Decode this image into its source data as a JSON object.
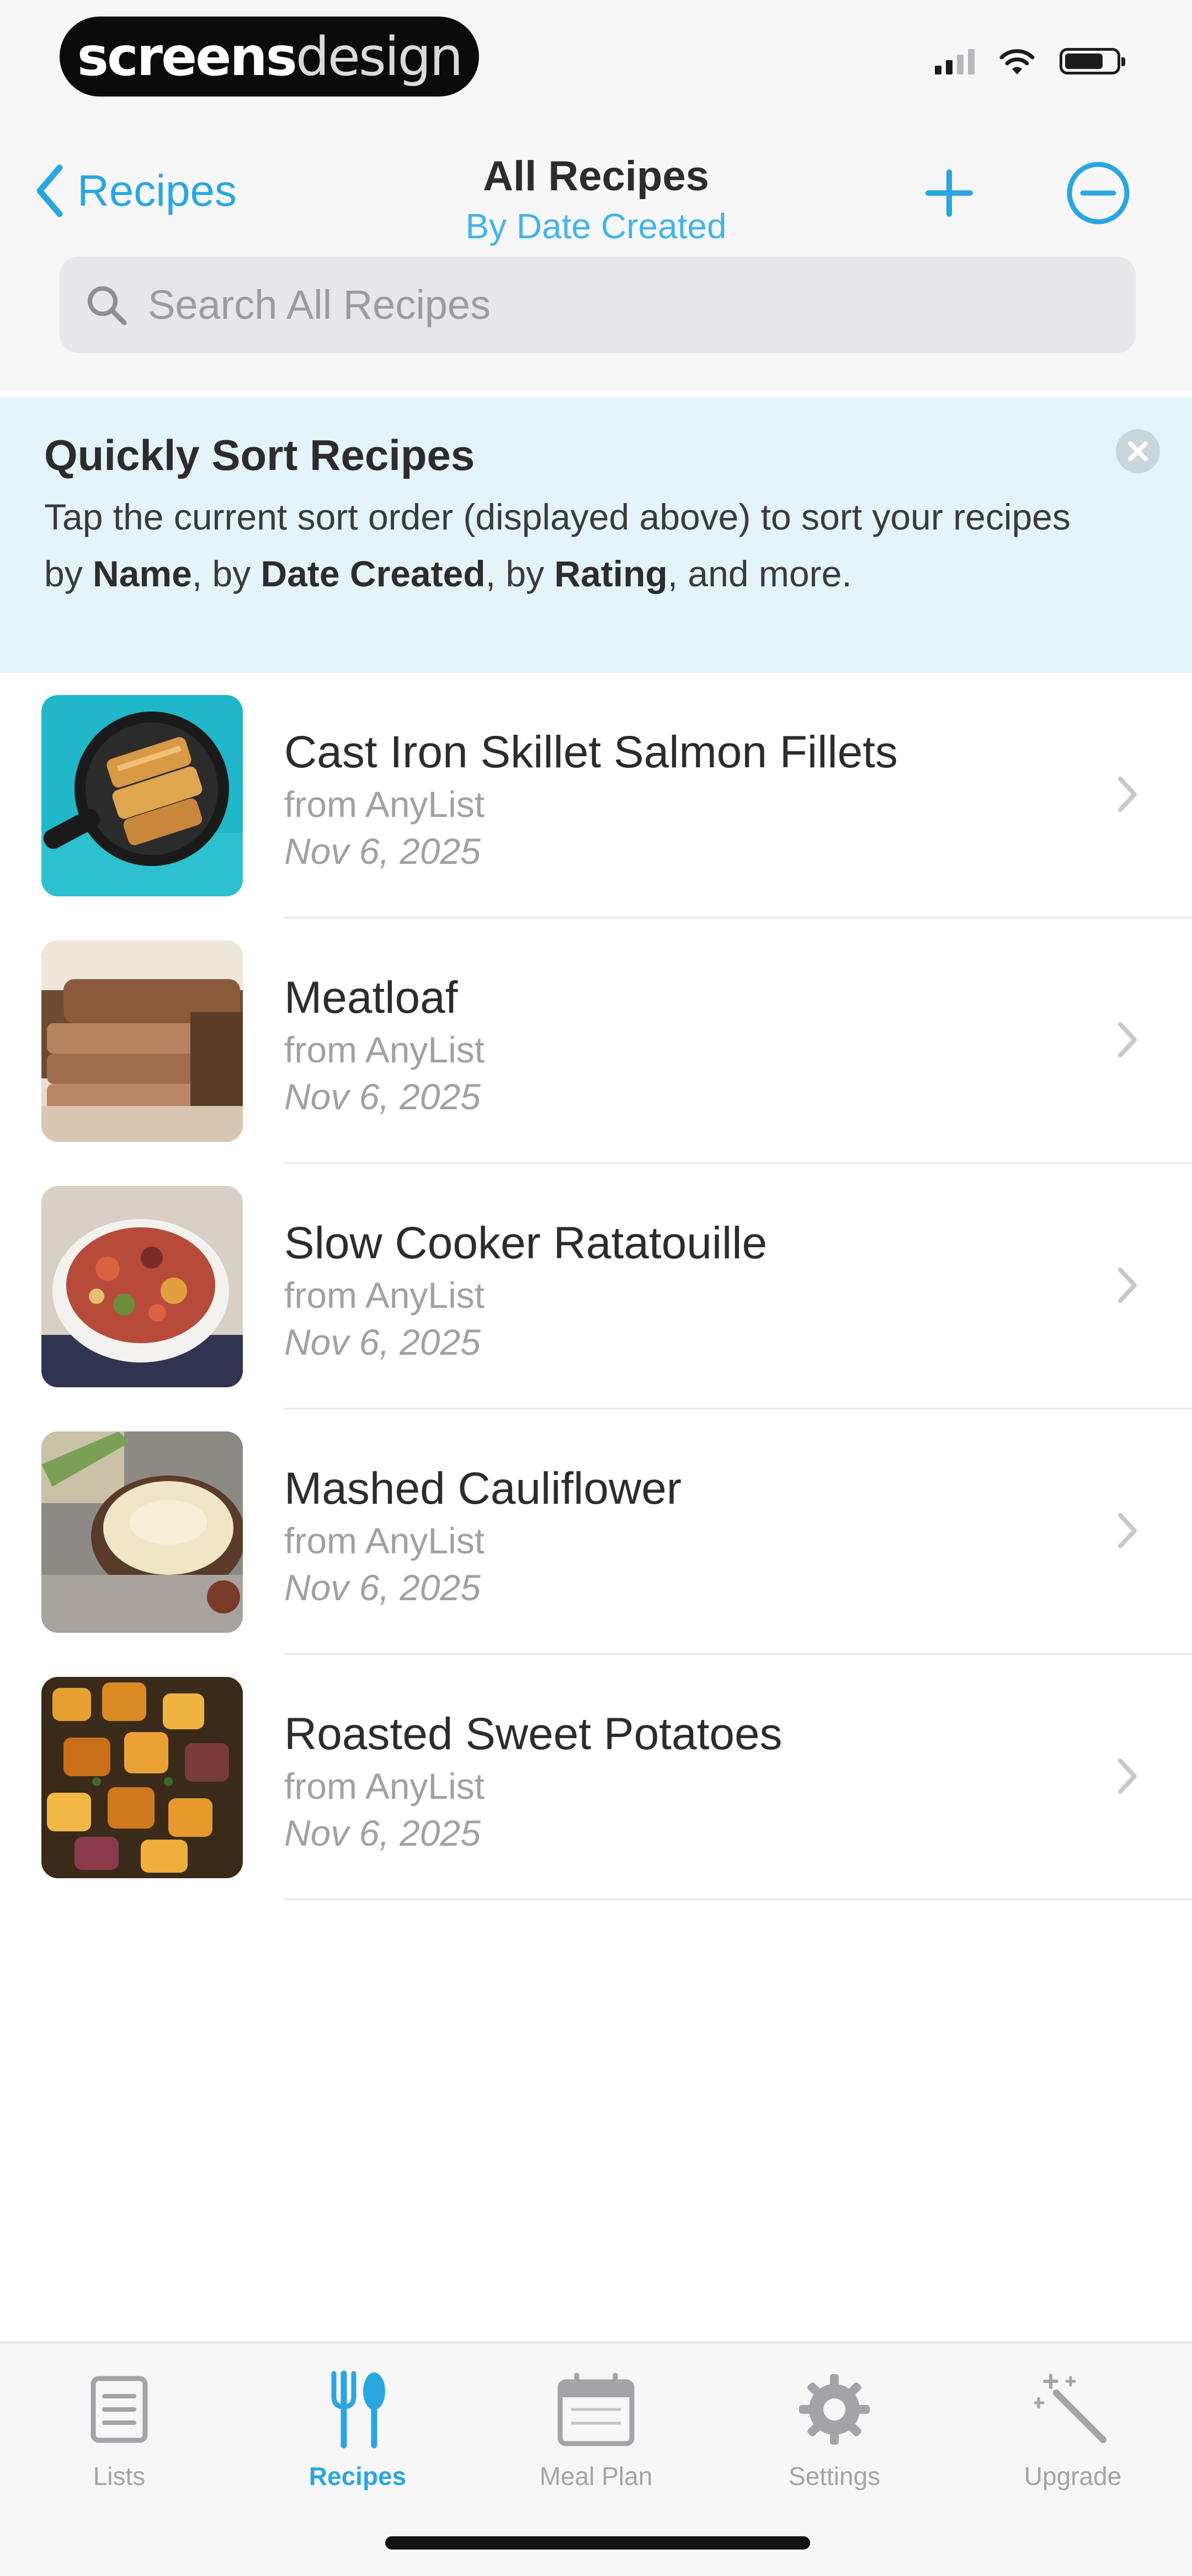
{
  "status_bar": {
    "brand_bold": "screens",
    "brand_light": "design"
  },
  "nav": {
    "back_label": "Recipes",
    "title": "All Recipes",
    "sort_order": "By Date Created",
    "add_icon": "plus-icon",
    "more_icon": "minus-circle-icon"
  },
  "search": {
    "placeholder": "Search All Recipes",
    "icon": "search-icon"
  },
  "tip": {
    "title": "Quickly Sort Recipes",
    "body_1": "Tap the current sort order (displayed above) to sort your recipes by ",
    "name": "Name",
    "body_2": ", by ",
    "date_created": "Date Created",
    "body_3": ", by ",
    "rating": "Rating",
    "body_4": ", and more."
  },
  "recipes": [
    {
      "title": "Cast Iron Skillet Salmon Fillets",
      "source": "from AnyList",
      "date": "Nov 6, 2025"
    },
    {
      "title": "Meatloaf",
      "source": "from AnyList",
      "date": "Nov 6, 2025"
    },
    {
      "title": "Slow Cooker Ratatouille",
      "source": "from AnyList",
      "date": "Nov 6, 2025"
    },
    {
      "title": "Mashed Cauliflower",
      "source": "from AnyList",
      "date": "Nov 6, 2025"
    },
    {
      "title": "Roasted Sweet Potatoes",
      "source": "from AnyList",
      "date": "Nov 6, 2025"
    }
  ],
  "tabs": [
    {
      "label": "Lists",
      "icon": "lists-icon"
    },
    {
      "label": "Recipes",
      "icon": "fork-spoon-icon",
      "active": true
    },
    {
      "label": "Meal Plan",
      "icon": "calendar-icon"
    },
    {
      "label": "Settings",
      "icon": "gear-icon"
    },
    {
      "label": "Upgrade",
      "icon": "magic-wand-icon"
    }
  ],
  "colors": {
    "accent": "#2aa6e0",
    "tip_background": "#e4f4fb",
    "bar_background": "#f7f7f8"
  }
}
